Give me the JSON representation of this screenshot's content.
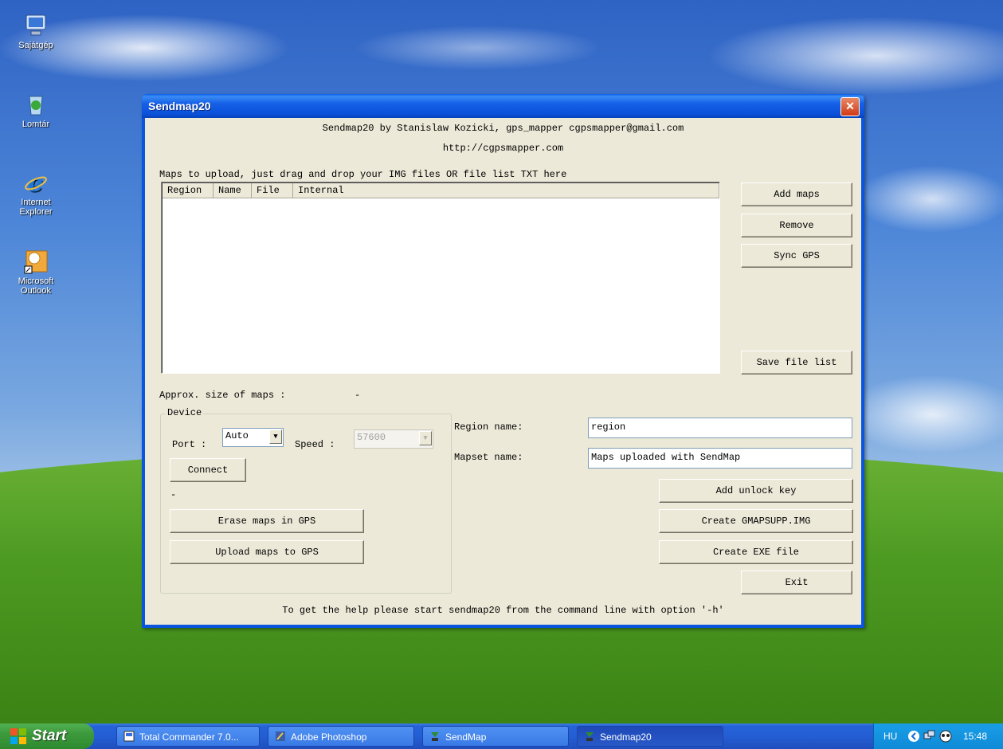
{
  "desktop": {
    "icons": [
      {
        "label": "Sajátgép"
      },
      {
        "label": "Lomtár"
      },
      {
        "label": "Internet Explorer"
      },
      {
        "label": "Microsoft Outlook"
      }
    ]
  },
  "window": {
    "title": "Sendmap20",
    "close_glyph": "✕",
    "header_line1": "Sendmap20 by Stanislaw Kozicki, gps_mapper cgpsmapper@gmail.com",
    "header_line2": "http://cgpsmapper.com",
    "drop_hint": "Maps to upload, just drag and drop your IMG files OR file list TXT here",
    "columns": [
      "Region",
      "Name",
      "File",
      "Internal"
    ],
    "rows": [],
    "buttons": {
      "add_maps": "Add maps",
      "remove": "Remove",
      "sync_gps": "Sync GPS",
      "save_file_list": "Save file list",
      "connect": "Connect",
      "erase_maps": "Erase maps in GPS",
      "upload_maps": "Upload maps to GPS",
      "add_unlock_key": "Add unlock key",
      "create_gmapsupp": "Create GMAPSUPP.IMG",
      "create_exe": "Create EXE file",
      "exit": "Exit"
    },
    "approx_size_label": "Approx. size of maps :",
    "approx_size_value": "-",
    "device": {
      "group_label": "Device",
      "port_label": "Port :",
      "port_value": "Auto",
      "speed_label": "Speed :",
      "speed_value": "57600",
      "status": "-"
    },
    "region_name_label": "Region name:",
    "region_name_value": "region",
    "mapset_name_label": "Mapset name:",
    "mapset_name_value": "Maps uploaded with SendMap",
    "footer": "To get the help please start sendmap20 from the command line with option '-h'"
  },
  "taskbar": {
    "start_label": "Start",
    "items": [
      {
        "label": "Total Commander 7.0..."
      },
      {
        "label": "Adobe Photoshop"
      },
      {
        "label": "SendMap"
      },
      {
        "label": "Sendmap20"
      }
    ],
    "tray": {
      "lang": "HU",
      "time": "15:48"
    }
  },
  "colors": {
    "titlebar": "#0a50d8",
    "client": "#ece9d8",
    "close": "#d23a14",
    "start": "#3c9a3c"
  }
}
